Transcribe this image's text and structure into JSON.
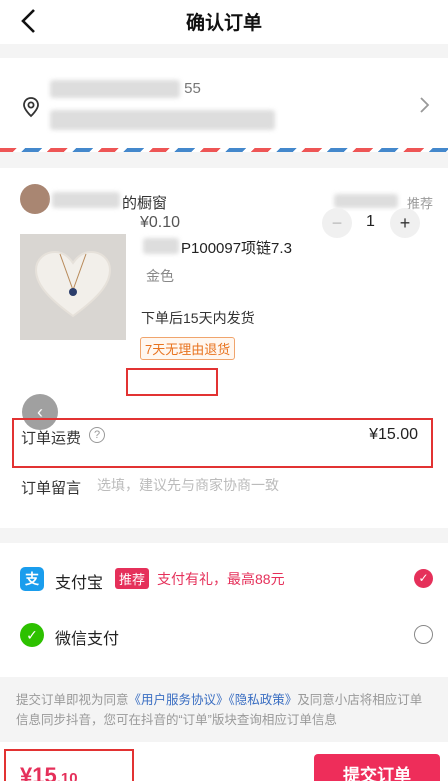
{
  "header": {
    "title": "确认订单"
  },
  "address": {
    "line1_suffix": "55"
  },
  "shop": {
    "name_suffix": "的橱窗",
    "recommend": "推荐"
  },
  "product": {
    "name_suffix": "P100097项链7.3",
    "variant": "金色",
    "ship_note": "下单后15天内发货",
    "tag": "7天无理由退货",
    "price": "¥0.10",
    "quantity": "1",
    "minus": "−",
    "plus": "+"
  },
  "shipping": {
    "label": "订单运费",
    "help": "?",
    "value": "¥15.00"
  },
  "note": {
    "label": "订单留言",
    "placeholder": "选填，建议先与商家协商一致"
  },
  "payment": {
    "alipay": {
      "icon_text": "支",
      "name": "支付宝",
      "badge": "推荐",
      "promo": "支付有礼，最高88元"
    },
    "wechat": {
      "icon_text": "✓",
      "name": "微信支付"
    }
  },
  "legal": {
    "pre": "提交订单即视为同意",
    "link1": "《用户服务协议》",
    "link2": "《隐私政策》",
    "post": "及同意小店将相应订单信息同步抖音，您可在抖音的“订单”版块查询相应订单信息"
  },
  "footer": {
    "total_main": "¥15",
    "total_dec": ".10",
    "submit": "提交订单"
  }
}
